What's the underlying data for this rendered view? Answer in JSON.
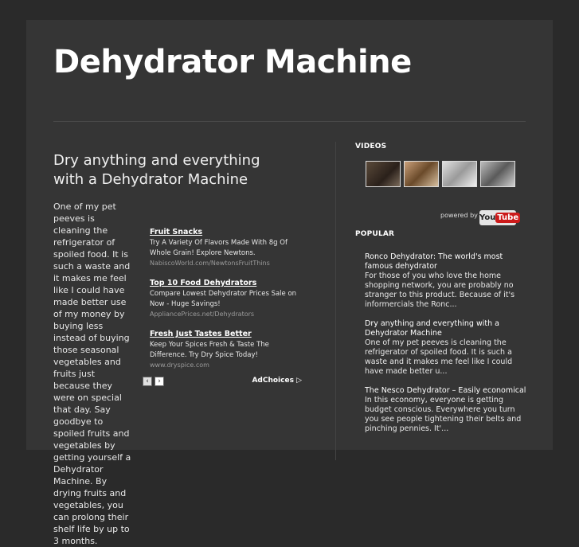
{
  "header": {
    "title": "Dehydrator Machine"
  },
  "post": {
    "title": "Dry anything and everything with a Dehydrator Machine",
    "body": "One of my pet peeves is cleaning the refrigerator of spoiled food. It is such a waste and it makes me feel like I could have made better use of my money by buying less instead of buying those seasonal vegetables and fruits just because they were on special that day. Say goodbye to spoiled fruits and vegetables by getting yourself a Dehydrator Machine. By drying fruits and vegetables, you can prolong their shelf life by up to 3 months."
  },
  "ads": [
    {
      "title": "Fruit Snacks",
      "desc": "Try A Variety Of Flavors Made With 8g Of Whole Grain! Explore Newtons.",
      "url": "NabiscoWorld.com/NewtonsFruitThins"
    },
    {
      "title": "Top 10 Food Dehydrators",
      "desc": "Compare Lowest Dehydrator Prices Sale on Now - Huge Savings!",
      "url": "AppliancePrices.net/Dehydrators"
    },
    {
      "title": "Fresh Just Tastes Better",
      "desc": "Keep Your Spices Fresh & Taste The Difference. Try Dry Spice Today!",
      "url": "www.dryspice.com"
    }
  ],
  "ad_nav": {
    "prev": "‹",
    "next": "›",
    "adchoices": "AdChoices ▷"
  },
  "sidebar": {
    "videos_heading": "VIDEOS",
    "powered_by": "powered by",
    "youtube_you": "You",
    "youtube_tube": "Tube",
    "popular_heading": "POPULAR",
    "popular": [
      {
        "title": "Ronco Dehydrator: The world's most famous dehydrator",
        "snippet": "For those of you who love the home shopping network, you are probably no stranger to this product. Because of it's informercials the Ronc..."
      },
      {
        "title": "Dry anything and everything with a Dehydrator Machine",
        "snippet": "One of my pet peeves is cleaning the refrigerator of spoiled food. It is such a waste and it makes me feel like I could have made better u..."
      },
      {
        "title": "The Nesco Dehydrator – Easily economical",
        "snippet": "In this economy, everyone is getting budget conscious. Everywhere you turn you see people tightening their belts and pinching pennies. It'..."
      }
    ]
  },
  "colors": {
    "background": "#2a2a2a",
    "panel": "#353535",
    "text": "#e8e8e8"
  }
}
